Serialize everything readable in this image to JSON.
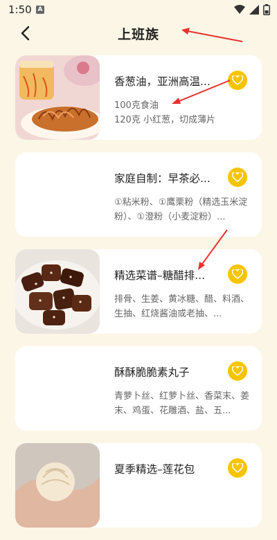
{
  "status": {
    "time": "1:50",
    "notif_letter": "A"
  },
  "header": {
    "title": "上班族"
  },
  "recipes": [
    {
      "title": "香葱油，亚洲高温...",
      "desc": "100克食油\n120克 小红葱，切成薄片",
      "thumb": "fried-shallots-photo"
    },
    {
      "title": "家庭自制：早茶必...",
      "desc": "①粘米粉、①鹰栗粉（精选玉米淀粉）、①澄粉（小麦淀粉）...",
      "thumb": ""
    },
    {
      "title": "精选菜谱–糖醋排...",
      "desc": "排骨、生姜、黄冰糖、醋、料酒、生抽、红烧酱油或老抽、...",
      "thumb": "sweet-sour-ribs-photo"
    },
    {
      "title": "酥酥脆脆素丸子",
      "desc": "青萝卜丝、红萝卜丝、香菜末、姜末、鸡蛋、花雕酒、盐、五...",
      "thumb": ""
    },
    {
      "title": "夏季精选–莲花包",
      "desc": "",
      "thumb": "lotus-bun-photo"
    }
  ],
  "colors": {
    "background": "#fbf6e6",
    "accent": "#f7c400",
    "annotation": "#e8322f"
  }
}
